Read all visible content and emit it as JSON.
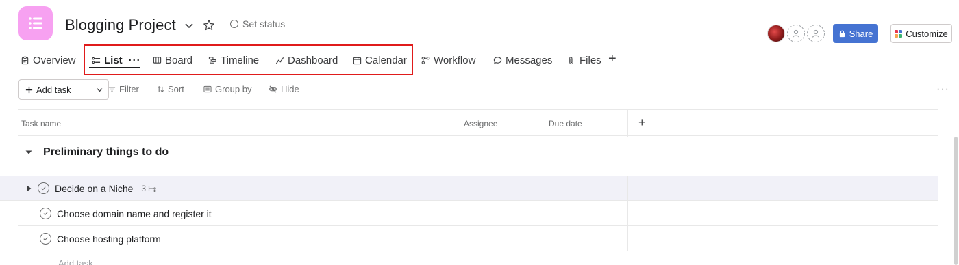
{
  "project": {
    "title": "Blogging Project",
    "set_status": "Set status"
  },
  "header": {
    "share_label": "Share",
    "customize_label": "Customize"
  },
  "tabs": [
    {
      "label": "Overview",
      "icon": "clipboard-icon"
    },
    {
      "label": "List",
      "icon": "list-icon",
      "active": true
    },
    {
      "label": "Board",
      "icon": "board-icon"
    },
    {
      "label": "Timeline",
      "icon": "timeline-icon"
    },
    {
      "label": "Dashboard",
      "icon": "dashboard-icon"
    },
    {
      "label": "Calendar",
      "icon": "calendar-icon"
    },
    {
      "label": "Workflow",
      "icon": "workflow-icon"
    },
    {
      "label": "Messages",
      "icon": "message-icon"
    },
    {
      "label": "Files",
      "icon": "paperclip-icon"
    }
  ],
  "toolbar": {
    "add_task": "Add task",
    "filter": "Filter",
    "sort": "Sort",
    "group_by": "Group by",
    "hide": "Hide"
  },
  "table": {
    "columns": [
      "Task name",
      "Assignee",
      "Due date"
    ]
  },
  "section": {
    "title": "Preliminary things to do",
    "tasks": [
      {
        "name": "Decide on a Niche",
        "subtasks": "3"
      },
      {
        "name": "Choose domain name and register it"
      },
      {
        "name": "Choose hosting platform"
      }
    ],
    "add_task": "Add task..."
  },
  "colors": {
    "app_icon": "#f7a1f1",
    "share_button": "#4573d2",
    "highlight_box": "#e01b1b",
    "row_highlight": "#f1f1f8"
  }
}
